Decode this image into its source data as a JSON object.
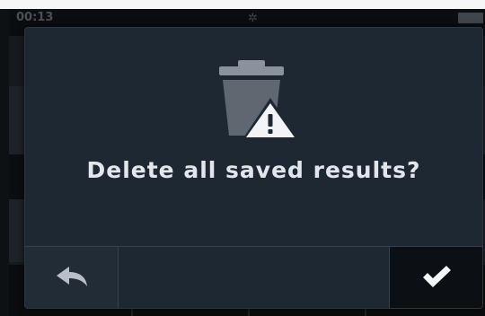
{
  "status_bar": {
    "time": "00:13"
  },
  "dialog": {
    "icon": "trash-warning-icon",
    "message": "Delete all saved results?",
    "back_button_icon": "back-arrow-icon",
    "confirm_button_icon": "checkmark-icon"
  },
  "colors": {
    "dialog_bg": "#1e2832",
    "icon": "#8a939d",
    "text": "#e4e7ea",
    "confirm_bg": "#0c1014"
  }
}
